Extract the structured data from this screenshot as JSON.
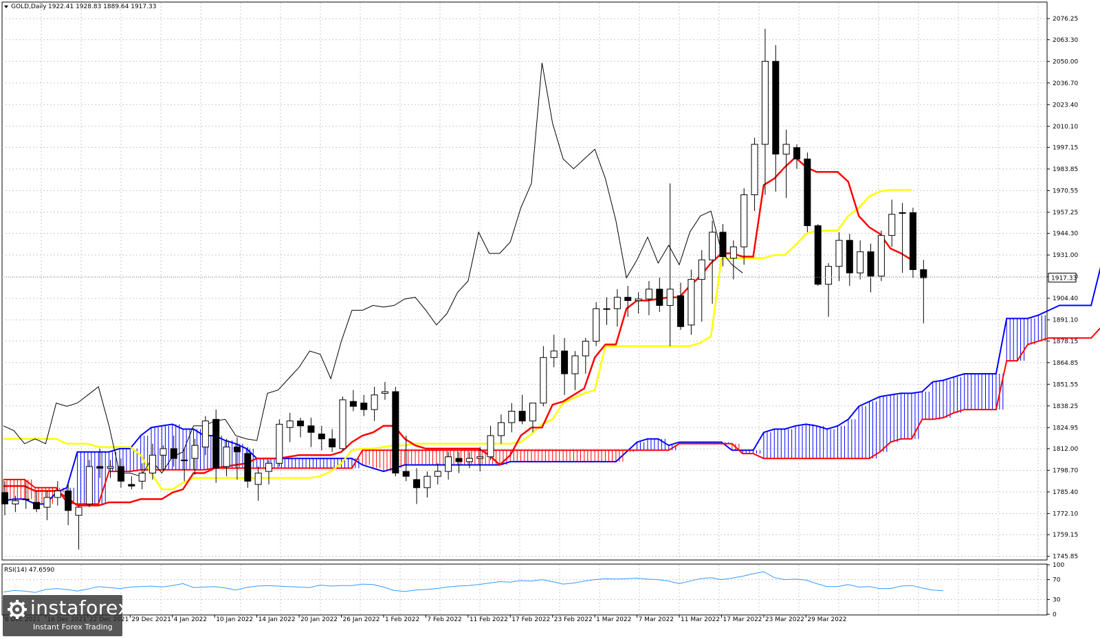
{
  "header": {
    "instrument": "GOLD,Daily",
    "ohlc": "1922.41 1928.83 1889.64 1917.33"
  },
  "current_price_label": "1917.33",
  "rsi_header": "RSI(14) 47.6590",
  "watermark": {
    "brand": "instaforex",
    "tagline": "Instant Forex Trading"
  },
  "colors": {
    "tenkan": "#ff0000",
    "kijun": "#ffff00",
    "span_a": "#0000ff",
    "span_b": "#ff0000",
    "chikou": "#000000",
    "rsi": "#3399ff",
    "grid": "#c8c8c8"
  },
  "chart_data": [
    {
      "type": "candlestick",
      "title": "",
      "y_ticks": [
        "2076.25",
        "2063.30",
        "2050.00",
        "2036.70",
        "2023.40",
        "2010.10",
        "1997.15",
        "1983.85",
        "1970.55",
        "1957.25",
        "1944.30",
        "1931.00",
        "1917.70",
        "1904.40",
        "1891.10",
        "1878.15",
        "1864.85",
        "1851.55",
        "1838.25",
        "1824.95",
        "1812.00",
        "1798.70",
        "1785.40",
        "1772.10",
        "1759.15",
        "1745.85"
      ],
      "ylim": [
        1744,
        2086
      ],
      "x_labels": [
        {
          "i": 0,
          "text": "6 Dec 2021"
        },
        {
          "i": 4,
          "text": "16 Dec 2021"
        },
        {
          "i": 8,
          "text": "22 Dec 2021"
        },
        {
          "i": 12,
          "text": "29 Dec 2021"
        },
        {
          "i": 16,
          "text": "4 Jan 2022"
        },
        {
          "i": 20,
          "text": "10 Jan 2022"
        },
        {
          "i": 24,
          "text": "14 Jan 2022"
        },
        {
          "i": 28,
          "text": "20 Jan 2022"
        },
        {
          "i": 32,
          "text": "26 Jan 2022"
        },
        {
          "i": 36,
          "text": "1 Feb 2022"
        },
        {
          "i": 40,
          "text": "7 Feb 2022"
        },
        {
          "i": 44,
          "text": "11 Feb 2022"
        },
        {
          "i": 48,
          "text": "17 Feb 2022"
        },
        {
          "i": 52,
          "text": "23 Feb 2022"
        },
        {
          "i": 56,
          "text": "1 Mar 2022"
        },
        {
          "i": 60,
          "text": "7 Mar 2022"
        },
        {
          "i": 64,
          "text": "11 Mar 2022"
        },
        {
          "i": 68,
          "text": "17 Mar 2022"
        },
        {
          "i": 72,
          "text": "23 Mar 2022"
        },
        {
          "i": 76,
          "text": "29 Mar 2022"
        }
      ],
      "candles": [
        [
          1785,
          1792,
          1771,
          1778
        ],
        [
          1778,
          1783,
          1773,
          1780
        ],
        [
          1781,
          1792,
          1775,
          1781
        ],
        [
          1779,
          1786,
          1773,
          1775
        ],
        [
          1776,
          1786,
          1768,
          1782
        ],
        [
          1782,
          1792,
          1777,
          1786
        ],
        [
          1786,
          1790,
          1765,
          1774
        ],
        [
          1771,
          1777,
          1750,
          1776
        ],
        [
          1778,
          1805,
          1776,
          1801
        ],
        [
          1801,
          1812,
          1794,
          1800
        ],
        [
          1800,
          1805,
          1794,
          1801
        ],
        [
          1801,
          1806,
          1788,
          1792
        ],
        [
          1790,
          1795,
          1787,
          1789
        ],
        [
          1792,
          1803,
          1787,
          1797
        ],
        [
          1797,
          1815,
          1793,
          1808
        ],
        [
          1808,
          1814,
          1798,
          1812
        ],
        [
          1812,
          1820,
          1801,
          1806
        ],
        [
          1805,
          1812,
          1792,
          1805
        ],
        [
          1806,
          1818,
          1796,
          1814
        ],
        [
          1813,
          1832,
          1808,
          1829
        ],
        [
          1830,
          1836,
          1791,
          1800
        ],
        [
          1801,
          1818,
          1795,
          1813
        ],
        [
          1813,
          1819,
          1793,
          1810
        ],
        [
          1809,
          1813,
          1788,
          1792
        ],
        [
          1790,
          1801,
          1780,
          1797
        ],
        [
          1798,
          1805,
          1790,
          1803
        ],
        [
          1803,
          1830,
          1801,
          1827
        ],
        [
          1825,
          1834,
          1816,
          1829
        ],
        [
          1829,
          1831,
          1819,
          1826
        ],
        [
          1826,
          1831,
          1813,
          1822
        ],
        [
          1821,
          1826,
          1811,
          1818
        ],
        [
          1818,
          1824,
          1810,
          1813
        ],
        [
          1812,
          1844,
          1811,
          1842
        ],
        [
          1841,
          1848,
          1835,
          1838
        ],
        [
          1840,
          1845,
          1832,
          1836
        ],
        [
          1836,
          1850,
          1829,
          1845
        ],
        [
          1846,
          1853,
          1842,
          1847
        ],
        [
          1847,
          1850,
          1795,
          1797
        ],
        [
          1798,
          1820,
          1792,
          1795
        ],
        [
          1793,
          1800,
          1778,
          1788
        ],
        [
          1788,
          1798,
          1782,
          1795
        ],
        [
          1795,
          1803,
          1790,
          1798
        ],
        [
          1798,
          1810,
          1793,
          1807
        ],
        [
          1806,
          1810,
          1797,
          1804
        ],
        [
          1804,
          1810,
          1800,
          1806
        ],
        [
          1806,
          1813,
          1798,
          1807
        ],
        [
          1807,
          1826,
          1805,
          1820
        ],
        [
          1820,
          1833,
          1815,
          1828
        ],
        [
          1828,
          1840,
          1822,
          1835
        ],
        [
          1835,
          1845,
          1827,
          1829
        ],
        [
          1829,
          1838,
          1822,
          1840
        ],
        [
          1840,
          1875,
          1838,
          1868
        ],
        [
          1868,
          1882,
          1862,
          1872
        ],
        [
          1872,
          1880,
          1845,
          1858
        ],
        [
          1858,
          1872,
          1848,
          1869
        ],
        [
          1869,
          1880,
          1858,
          1878
        ],
        [
          1878,
          1902,
          1875,
          1898
        ],
        [
          1898,
          1905,
          1888,
          1898
        ],
        [
          1898,
          1910,
          1887,
          1905
        ],
        [
          1905,
          1912,
          1893,
          1903
        ],
        [
          1903,
          1908,
          1895,
          1904
        ],
        [
          1904,
          1915,
          1894,
          1910
        ],
        [
          1910,
          1917,
          1896,
          1900
        ],
        [
          1900,
          1975,
          1875,
          1910
        ],
        [
          1906,
          1914,
          1885,
          1887
        ],
        [
          1888,
          1922,
          1882,
          1916
        ],
        [
          1916,
          1934,
          1890,
          1928
        ],
        [
          1928,
          1952,
          1901,
          1945
        ],
        [
          1945,
          1950,
          1924,
          1930
        ],
        [
          1929,
          1940,
          1916,
          1936
        ],
        [
          1936,
          1972,
          1925,
          1968
        ],
        [
          1968,
          2003,
          1958,
          1999
        ],
        [
          1999,
          2070,
          1968,
          2050
        ],
        [
          2050,
          2060,
          1970,
          1993
        ],
        [
          1993,
          2008,
          1966,
          1999
        ],
        [
          1997,
          1999,
          1984,
          1990
        ],
        [
          1990,
          1994,
          1945,
          1949
        ],
        [
          1949,
          1950,
          1912,
          1913
        ],
        [
          1913,
          1926,
          1893,
          1924
        ],
        [
          1924,
          1945,
          1915,
          1940
        ],
        [
          1940,
          1944,
          1912,
          1920
        ],
        [
          1920,
          1940,
          1916,
          1933
        ],
        [
          1933,
          1938,
          1908,
          1918
        ],
        [
          1918,
          1946,
          1915,
          1943
        ],
        [
          1943,
          1965,
          1936,
          1956
        ],
        [
          1957,
          1963,
          1920,
          1957
        ],
        [
          1957,
          1960,
          1917,
          1922
        ],
        [
          1922,
          1928,
          1889,
          1917
        ]
      ],
      "tenkan_sen": [
        1789,
        1789,
        1789,
        1786,
        1786,
        1786,
        1782,
        1777,
        1777,
        1777,
        1779,
        1779,
        1779,
        1781,
        1781,
        1781,
        1785,
        1787,
        1797,
        1797,
        1800,
        1801,
        1802,
        1803,
        1806,
        1806,
        1806,
        1807,
        1808,
        1808,
        1808,
        1808,
        1810,
        1816,
        1820,
        1822,
        1826,
        1826,
        1818,
        1814,
        1812,
        1812,
        1812,
        1812,
        1812,
        1812,
        1808,
        1802,
        1808,
        1820,
        1825,
        1825,
        1839,
        1841,
        1845,
        1849,
        1868,
        1876,
        1876,
        1898,
        1903,
        1903,
        1904,
        1905,
        1905,
        1912,
        1918,
        1926,
        1932,
        1932,
        1930,
        1930,
        1974,
        1978,
        1985,
        1991,
        1985,
        1982,
        1982,
        1982,
        1976,
        1955,
        1948,
        1944,
        1935,
        1932,
        1928
      ],
      "kijun_sen": [
        1818,
        1818,
        1818,
        1818,
        1818,
        1818,
        1815,
        1815,
        1815,
        1813,
        1813,
        1813,
        1813,
        1808,
        1797,
        1787,
        1787,
        1791,
        1794,
        1794,
        1794,
        1794,
        1794,
        1794,
        1794,
        1794,
        1794,
        1794,
        1794,
        1794,
        1795,
        1798,
        1803,
        1811,
        1812,
        1812,
        1813,
        1814,
        1814,
        1815,
        1815,
        1815,
        1815,
        1815,
        1815,
        1815,
        1815,
        1815,
        1815,
        1816,
        1821,
        1827,
        1830,
        1840,
        1843,
        1846,
        1848,
        1875,
        1875,
        1875,
        1875,
        1875,
        1875,
        1875,
        1875,
        1875,
        1877,
        1881,
        1929,
        1929,
        1929,
        1929,
        1929,
        1931,
        1931,
        1937,
        1944,
        1946,
        1946,
        1946,
        1955,
        1960,
        1967,
        1970,
        1971,
        1971,
        1971
      ],
      "span_a": [
        1780,
        1781,
        1781,
        1778,
        1778,
        1785,
        1788,
        1810,
        1810,
        1810,
        1810,
        1812,
        1812,
        1820,
        1825,
        1826,
        1827,
        1824,
        1824,
        1820,
        1820,
        1817,
        1815,
        1812,
        1806,
        1806,
        1806,
        1806,
        1806,
        1806,
        1806,
        1806,
        1806,
        1806,
        1802,
        1800,
        1798,
        1800,
        1802,
        1802,
        1802,
        1802,
        1802,
        1802,
        1802,
        1802,
        1802,
        1802,
        1804,
        1804,
        1804,
        1804,
        1804,
        1804,
        1804,
        1804,
        1804,
        1804,
        1804,
        1810,
        1816,
        1818,
        1818,
        1814,
        1816,
        1816,
        1816,
        1816,
        1816,
        1811,
        1811,
        1811,
        1822,
        1824,
        1824,
        1826,
        1827,
        1826,
        1824,
        1826,
        1830,
        1838,
        1841,
        1844,
        1845,
        1846,
        1846,
        1847,
        1853,
        1854,
        1856,
        1858,
        1858,
        1858,
        1858,
        1892,
        1892,
        1892,
        1894,
        1897,
        1900,
        1900,
        1900,
        1900,
        1926,
        1954,
        1955,
        1955,
        1957,
        1960,
        1962,
        1962,
        1964,
        1964,
        1964,
        1964,
        1964,
        1966,
        1952,
        1952
      ],
      "span_b": [
        1793,
        1793,
        1793,
        1788,
        1788,
        1788,
        1779,
        1778,
        1778,
        1778,
        1798,
        1798,
        1798,
        1799,
        1799,
        1799,
        1799,
        1799,
        1799,
        1799,
        1800,
        1800,
        1800,
        1800,
        1800,
        1800,
        1800,
        1800,
        1800,
        1800,
        1800,
        1800,
        1800,
        1800,
        1811,
        1811,
        1811,
        1811,
        1811,
        1811,
        1811,
        1811,
        1811,
        1811,
        1811,
        1811,
        1811,
        1811,
        1811,
        1811,
        1811,
        1811,
        1811,
        1811,
        1811,
        1811,
        1811,
        1811,
        1811,
        1811,
        1811,
        1811,
        1811,
        1811,
        1815,
        1815,
        1815,
        1815,
        1815,
        1815,
        1809,
        1809,
        1806,
        1806,
        1806,
        1806,
        1806,
        1806,
        1806,
        1806,
        1806,
        1806,
        1806,
        1810,
        1816,
        1818,
        1818,
        1830,
        1830,
        1831,
        1834,
        1836,
        1836,
        1836,
        1836,
        1866,
        1866,
        1876,
        1878,
        1880,
        1880,
        1880,
        1880,
        1880,
        1887,
        1927,
        1927,
        1927,
        1927,
        1927,
        1927,
        1927,
        1927,
        1927,
        1927,
        1927,
        1927,
        1927,
        1927,
        1927
      ],
      "chikou_span": [
        1826,
        1823,
        1815,
        1818,
        1815,
        1840,
        1838,
        1840,
        1845,
        1850,
        1826,
        1797,
        1797,
        1795,
        1805,
        1797,
        1807,
        1810,
        1826,
        1826,
        1829,
        1830,
        1820,
        1818,
        1817,
        1846,
        1848,
        1855,
        1862,
        1872,
        1870,
        1855,
        1878,
        1897,
        1897,
        1900,
        1899,
        1900,
        1904,
        1905,
        1897,
        1888,
        1895,
        1908,
        1915,
        1945,
        1932,
        1932,
        1939,
        1960,
        1975,
        2049,
        2012,
        1990,
        1984,
        1990,
        1996,
        1978,
        1952,
        1917,
        1928,
        1942,
        1926,
        1937,
        1925,
        1945,
        1955,
        1958,
        1933,
        1925,
        1920
      ],
      "chikou_start_index": 0
    },
    {
      "type": "line",
      "title": "RSI(14) 47.6590",
      "y_ticks": [
        "100",
        "70",
        "30",
        "0"
      ],
      "ylim": [
        0,
        100
      ],
      "values": [
        45,
        48,
        47,
        44,
        50,
        52,
        50,
        47,
        51,
        56,
        54,
        52,
        55,
        56,
        57,
        55,
        58,
        62,
        54,
        55,
        56,
        53,
        49,
        54,
        57,
        58,
        57,
        56,
        55,
        54,
        59,
        57,
        58,
        58,
        61,
        60,
        55,
        48,
        46,
        49,
        50,
        52,
        55,
        57,
        58,
        60,
        63,
        66,
        65,
        68,
        67,
        70,
        66,
        61,
        63,
        67,
        70,
        72,
        71,
        72,
        73,
        71,
        70,
        67,
        62,
        67,
        72,
        74,
        70,
        73,
        77,
        82,
        86,
        74,
        70,
        71,
        69,
        62,
        56,
        56,
        60,
        55,
        56,
        52,
        52,
        57,
        58,
        53,
        49,
        47.66
      ]
    }
  ]
}
